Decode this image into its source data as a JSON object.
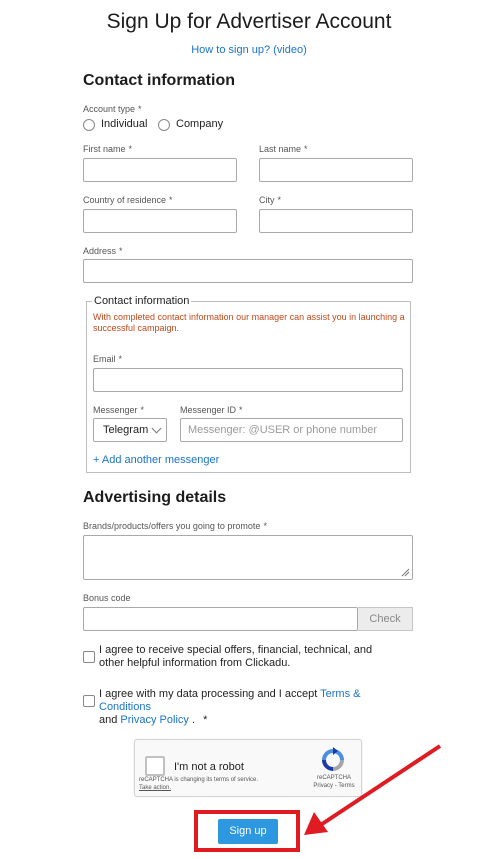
{
  "header": {
    "title": "Sign Up for Advertiser Account",
    "howto_link": "How to sign up? (video)"
  },
  "contact": {
    "heading": "Contact information",
    "account_type_label": "Account type",
    "required_mark": "*",
    "account_types": [
      "Individual",
      "Company"
    ],
    "first_name_label": "First name",
    "last_name_label": "Last name",
    "country_label": "Country of residence",
    "city_label": "City",
    "address_label": "Address",
    "inner": {
      "legend": "Contact information",
      "note": "With completed contact information our manager can assist you in launching a successful campaign.",
      "email_label": "Email",
      "messenger_label": "Messenger",
      "messenger_id_label": "Messenger ID",
      "messenger_value": "Telegram",
      "messenger_id_placeholder": "Messenger: @USER or phone number",
      "add_messenger": "+ Add another messenger"
    }
  },
  "advertising": {
    "heading": "Advertising details",
    "brands_label": "Brands/products/offers you going to promote",
    "bonus_label": "Bonus code",
    "check_button": "Check"
  },
  "agreements": {
    "offers": "I agree to receive special offers, financial, technical, and other helpful information from Clickadu.",
    "data_prefix": "I agree with my data processing and I accept",
    "terms_link": "Terms & Conditions",
    "and": "and",
    "privacy_link": "Privacy Policy",
    "suffix": "."
  },
  "captcha": {
    "label": "I'm not a robot",
    "notice": "reCAPTCHA is changing its terms of service.",
    "action": "Take action.",
    "brand": "reCAPTCHA",
    "links": "Privacy - Terms"
  },
  "submit": {
    "label": "Sign up"
  },
  "colors": {
    "accent": "#2d97e0",
    "link": "#1a73c9",
    "highlight": "#e11b22",
    "note": "#c14a1c"
  }
}
